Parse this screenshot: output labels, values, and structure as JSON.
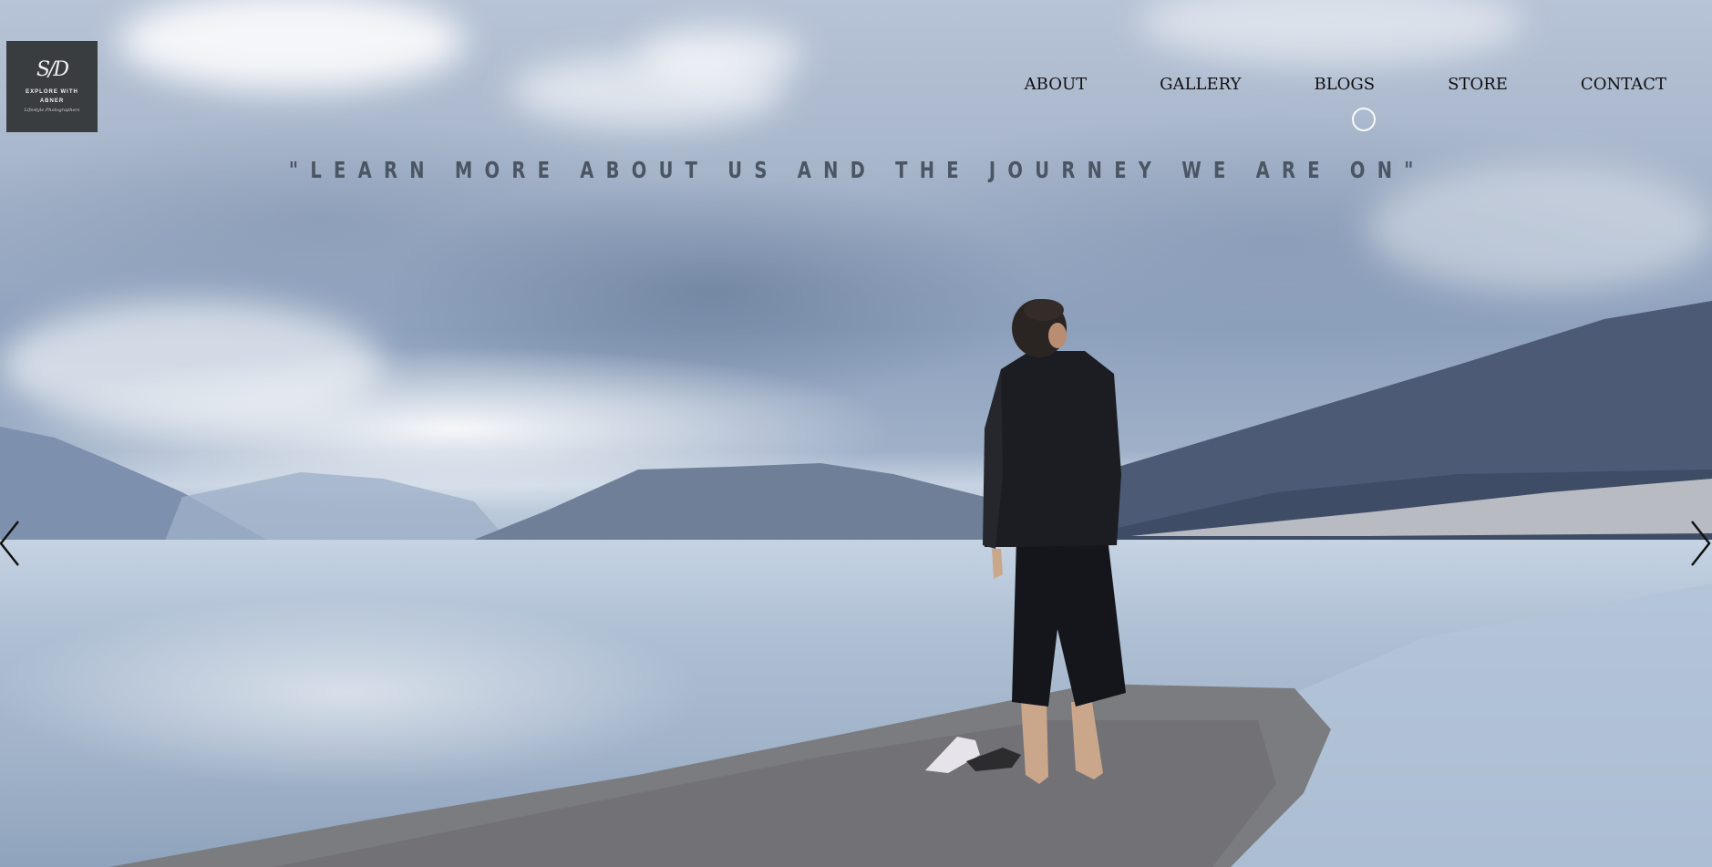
{
  "logo": {
    "mark": "S/D",
    "title_line1": "EXPLORE WITH",
    "title_line2": "ABNER",
    "subtitle": "Lifestyle Photographers"
  },
  "nav": {
    "items": [
      "ABOUT",
      "GALLERY",
      "BLOGS",
      "STORE",
      "CONTACT"
    ]
  },
  "hero": {
    "tagline": "\"LEARN MORE ABOUT US AND THE JOURNEY WE ARE ON\""
  },
  "slider": {
    "prev_icon": "chevron-left-icon",
    "next_icon": "chevron-right-icon"
  },
  "colors": {
    "logo_bg": "#3a3d40",
    "nav_text": "#111111",
    "tagline_text": "#4b5563"
  }
}
